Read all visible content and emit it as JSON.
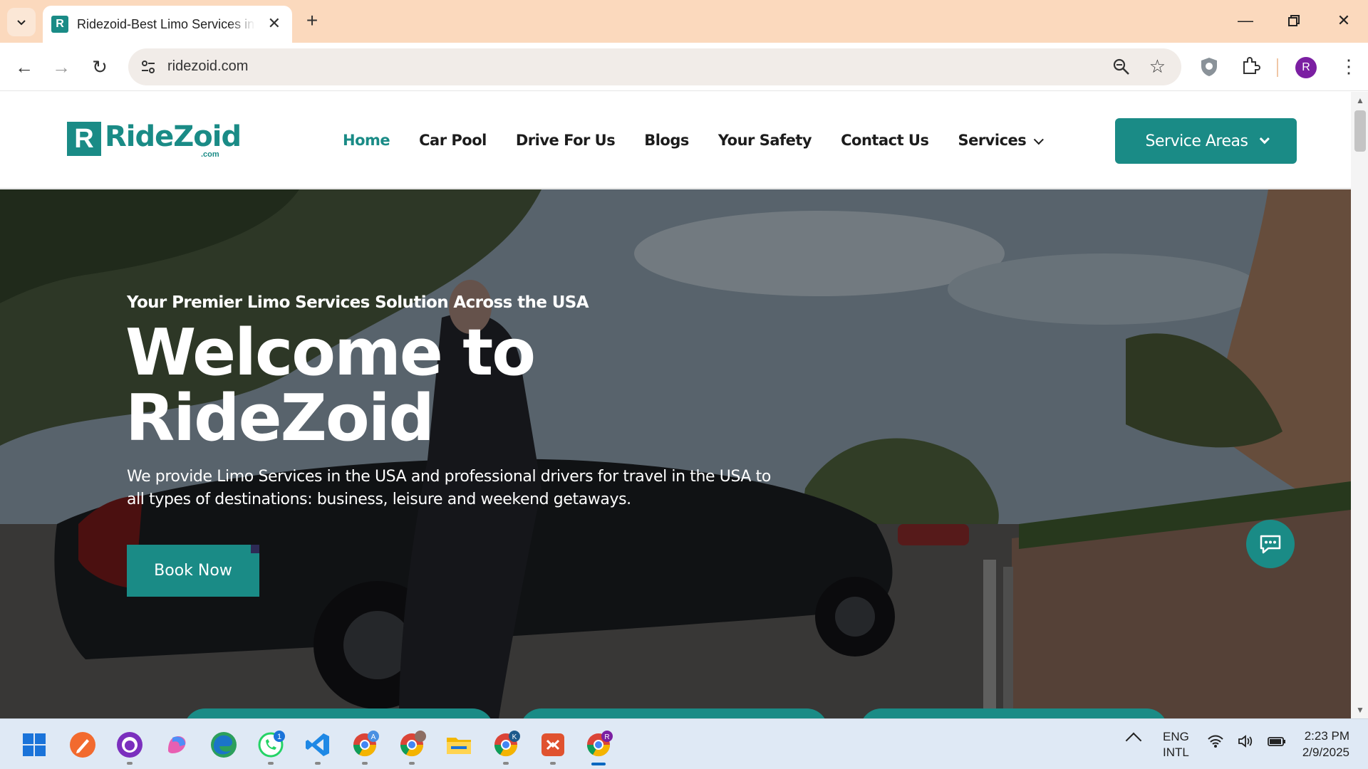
{
  "browser": {
    "tab_title": "Ridezoid-Best Limo Services in the USA",
    "favicon_letter": "R",
    "url": "ridezoid.com",
    "profile_initial": "R"
  },
  "site": {
    "logo": {
      "mark": "R",
      "name": "RideZoid",
      "suffix": ".com"
    },
    "nav": [
      {
        "label": "Home",
        "active": true
      },
      {
        "label": "Car Pool",
        "active": false
      },
      {
        "label": "Drive For Us",
        "active": false
      },
      {
        "label": "Blogs",
        "active": false
      },
      {
        "label": "Your Safety",
        "active": false
      },
      {
        "label": "Contact Us",
        "active": false
      },
      {
        "label": "Services",
        "active": false,
        "dropdown": true
      }
    ],
    "service_areas_label": "Service Areas",
    "accent_color": "#1a8b86"
  },
  "hero": {
    "tagline": "Your Premier Limo Services Solution Across the USA",
    "title_line1": "Welcome to",
    "title_line2": "RideZoid",
    "description": "We provide Limo Services in the USA and professional drivers for travel in the USA to all types of destinations: business, leisure and weekend getaways.",
    "cta_label": "Book Now"
  },
  "taskbar": {
    "apps": [
      {
        "name": "start-icon"
      },
      {
        "name": "pen-app-icon"
      },
      {
        "name": "github-desktop-icon"
      },
      {
        "name": "copilot-icon"
      },
      {
        "name": "edge-icon"
      },
      {
        "name": "whatsapp-icon",
        "badge": "1"
      },
      {
        "name": "vscode-icon"
      },
      {
        "name": "chrome-profile-a-icon",
        "badge": "A"
      },
      {
        "name": "chrome-profile-photo-icon"
      },
      {
        "name": "file-explorer-icon"
      },
      {
        "name": "chrome-profile-k-icon",
        "badge": "K"
      },
      {
        "name": "remote-app-icon"
      },
      {
        "name": "chrome-profile-r-icon",
        "badge": "R"
      }
    ],
    "language_line1": "ENG",
    "language_line2": "INTL",
    "time": "2:23 PM",
    "date": "2/9/2025"
  }
}
